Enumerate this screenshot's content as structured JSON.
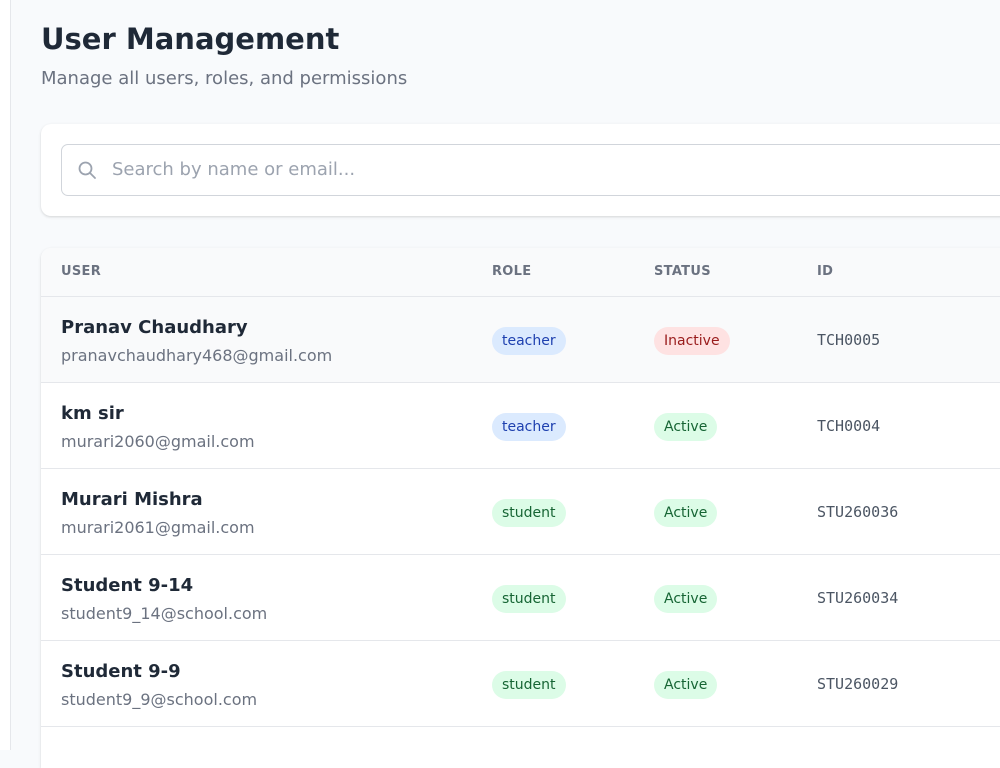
{
  "header": {
    "title": "User Management",
    "subtitle": "Manage all users, roles, and permissions"
  },
  "search": {
    "icon": "search-icon",
    "placeholder": "Search by name or email...",
    "value": ""
  },
  "table": {
    "columns": {
      "user": "USER",
      "role": "ROLE",
      "status": "STATUS",
      "id": "ID"
    },
    "rows": [
      {
        "name": "Pranav Chaudhary",
        "email": "pranavchaudhary468@gmail.com",
        "role": "teacher",
        "status": "Inactive",
        "id": "TCH0005"
      },
      {
        "name": "km sir",
        "email": "murari2060@gmail.com",
        "role": "teacher",
        "status": "Active",
        "id": "TCH0004"
      },
      {
        "name": "Murari Mishra",
        "email": "murari2061@gmail.com",
        "role": "student",
        "status": "Active",
        "id": "STU260036"
      },
      {
        "name": "Student 9-14",
        "email": "student9_14@school.com",
        "role": "student",
        "status": "Active",
        "id": "STU260034"
      },
      {
        "name": "Student 9-9",
        "email": "student9_9@school.com",
        "role": "student",
        "status": "Active",
        "id": "STU260029"
      }
    ]
  },
  "colors": {
    "teacher_badge_bg": "#dbeafe",
    "teacher_badge_text": "#1e40af",
    "student_badge_bg": "#dcfce7",
    "student_badge_text": "#166534",
    "active_badge_bg": "#dcfce7",
    "active_badge_text": "#166534",
    "inactive_badge_bg": "#fee2e2",
    "inactive_badge_text": "#991b1b"
  }
}
